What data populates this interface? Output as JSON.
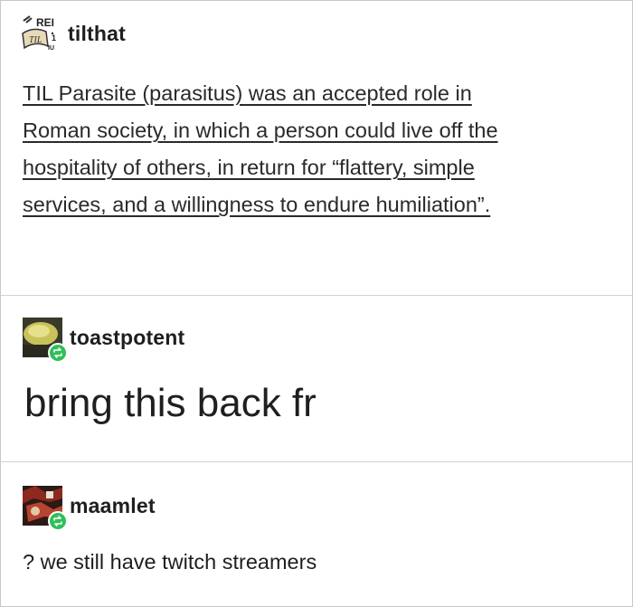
{
  "posts": [
    {
      "username": "tilthat",
      "avatar_icon": "til-logo-icon",
      "lines": [
        "TIL Parasite (parasitus) was an accepted role in",
        "Roman society, in which a person could live off the",
        "hospitality of others, in return for “flattery, simple",
        "services, and a willingness to endure humiliation”."
      ]
    },
    {
      "username": "toastpotent",
      "avatar_icon": "toast-avatar-icon",
      "badge_icon": "reblog-icon",
      "text": "bring this back fr"
    },
    {
      "username": "maamlet",
      "avatar_icon": "maamlet-avatar-icon",
      "badge_icon": "reblog-icon",
      "text": "? we still have twitch streamers"
    }
  ],
  "colors": {
    "reblog_badge": "#2fbf5a",
    "divider": "#d2d2d2"
  }
}
